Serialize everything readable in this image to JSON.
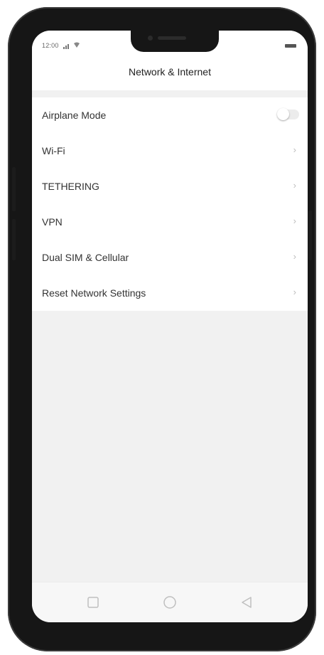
{
  "status_bar": {
    "time": "12:00"
  },
  "header": {
    "title": "Network & Internet"
  },
  "settings": {
    "items": [
      {
        "label": "Airplane Mode",
        "control": "toggle",
        "toggle_on": false
      },
      {
        "label": "Wi-Fi",
        "control": "chevron"
      },
      {
        "label": "TETHERING",
        "control": "chevron"
      },
      {
        "label": "VPN",
        "control": "chevron"
      },
      {
        "label": "Dual SIM & Cellular",
        "control": "chevron"
      },
      {
        "label": "Reset Network Settings",
        "control": "chevron"
      }
    ]
  },
  "nav_bar": {
    "buttons": [
      "square-recents-icon",
      "circle-home-icon",
      "triangle-back-icon"
    ]
  },
  "colors": {
    "phone_body": "#161616",
    "screen_background": "#f1f1f1",
    "list_background": "#ffffff",
    "text_primary": "#333333",
    "chevron": "#bdbdbd"
  }
}
